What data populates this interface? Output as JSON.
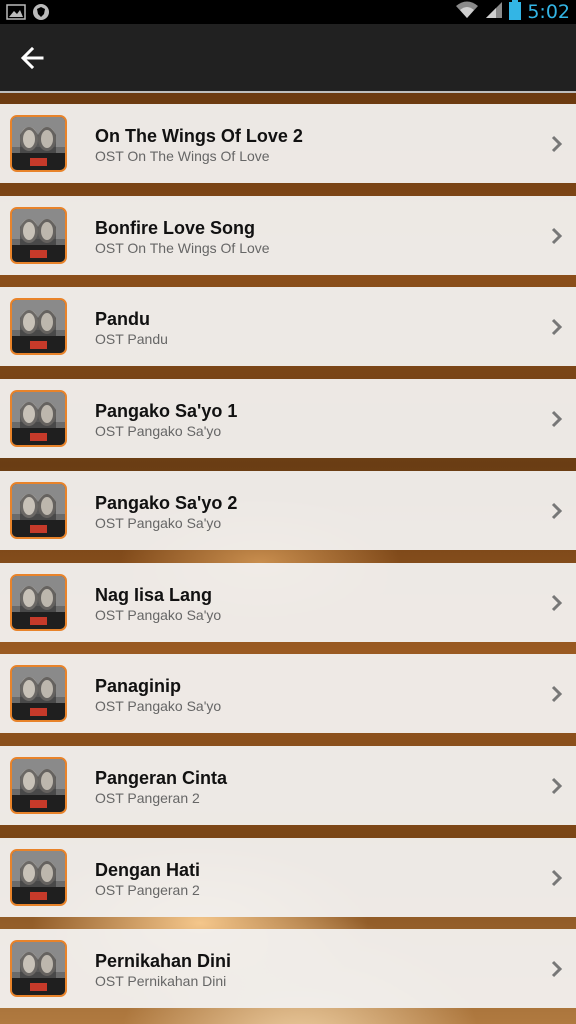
{
  "status_bar": {
    "time": "5:02",
    "icons": [
      "image-icon",
      "shield-icon",
      "wifi-icon",
      "signal-icon",
      "battery-icon"
    ]
  },
  "action_bar": {
    "back_icon": "arrow-left-icon"
  },
  "colors": {
    "accent": "#33b5e5",
    "thumb_border": "#e8832a",
    "row_bg": "#f1efed"
  },
  "songs": [
    {
      "title": "On The Wings Of Love 2",
      "subtitle": "OST On The Wings Of Love"
    },
    {
      "title": "Bonfire Love Song",
      "subtitle": "OST On The Wings Of Love"
    },
    {
      "title": "Pandu",
      "subtitle": "OST Pandu"
    },
    {
      "title": "Pangako Sa'yo 1",
      "subtitle": "OST Pangako Sa'yo"
    },
    {
      "title": "Pangako Sa'yo 2",
      "subtitle": "OST Pangako Sa'yo"
    },
    {
      "title": "Nag Iisa Lang",
      "subtitle": "OST Pangako Sa'yo"
    },
    {
      "title": "Panaginip",
      "subtitle": "OST Pangako Sa'yo"
    },
    {
      "title": "Pangeran Cinta",
      "subtitle": "OST Pangeran 2"
    },
    {
      "title": "Dengan Hati",
      "subtitle": "OST Pangeran 2"
    },
    {
      "title": "Pernikahan Dini",
      "subtitle": "OST Pernikahan Dini"
    }
  ]
}
